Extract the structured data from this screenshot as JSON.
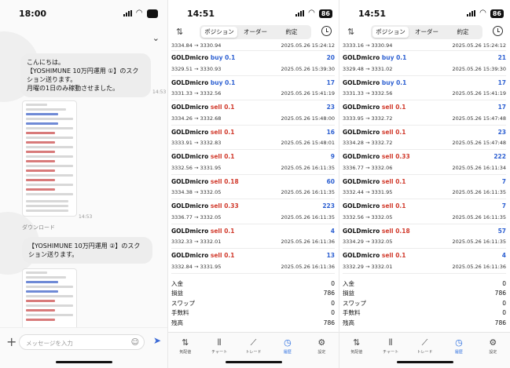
{
  "chat": {
    "status_time": "18:00",
    "messages": [
      {
        "lines": [
          "こんにちは。",
          "【YOSHIMUNE 10万円運用 ①】のスク",
          "ション送ります。",
          "月曜の1日のみ稼動させました。"
        ],
        "time": "14:53"
      },
      {
        "time": "14:53"
      },
      {
        "lines": [
          "【YOSHIMUNE 10万円運用 ②】のスク",
          "ション送ります。"
        ]
      }
    ],
    "download_label": "ダウンロード",
    "input_placeholder": "メッセージを入力"
  },
  "panels": [
    {
      "status_time": "14:51",
      "battery": "86",
      "tabs": [
        "ポジション",
        "オーダー",
        "約定"
      ],
      "active_tab": 0,
      "first_row": {
        "prices": "3334.84 → 3330.94",
        "datetime": "2025.05.26 15:24:12"
      },
      "trades": [
        {
          "symbol": "GOLDmicro",
          "side": "buy",
          "lots": "0.1",
          "pl": "20",
          "prices": "3329.51 → 3330.93",
          "datetime": "2025.05.26 15:39:30"
        },
        {
          "symbol": "GOLDmicro",
          "side": "buy",
          "lots": "0.1",
          "pl": "17",
          "prices": "3331.33 → 3332.56",
          "datetime": "2025.05.26 15:41:19"
        },
        {
          "symbol": "GOLDmicro",
          "side": "sell",
          "lots": "0.1",
          "pl": "23",
          "prices": "3334.26 → 3332.68",
          "datetime": "2025.05.26 15:48:00"
        },
        {
          "symbol": "GOLDmicro",
          "side": "sell",
          "lots": "0.1",
          "pl": "16",
          "prices": "3333.91 → 3332.83",
          "datetime": "2025.05.26 15:48:01"
        },
        {
          "symbol": "GOLDmicro",
          "side": "sell",
          "lots": "0.1",
          "pl": "9",
          "prices": "3332.56 → 3331.95",
          "datetime": "2025.05.26 16:11:35"
        },
        {
          "symbol": "GOLDmicro",
          "side": "sell",
          "lots": "0.18",
          "pl": "60",
          "prices": "3334.38 → 3332.05",
          "datetime": "2025.05.26 16:11:35"
        },
        {
          "symbol": "GOLDmicro",
          "side": "sell",
          "lots": "0.33",
          "pl": "223",
          "prices": "3336.77 → 3332.05",
          "datetime": "2025.05.26 16:11:35"
        },
        {
          "symbol": "GOLDmicro",
          "side": "sell",
          "lots": "0.1",
          "pl": "4",
          "prices": "3332.33 → 3332.01",
          "datetime": "2025.05.26 16:11:36"
        },
        {
          "symbol": "GOLDmicro",
          "side": "sell",
          "lots": "0.1",
          "pl": "13",
          "prices": "3332.84 → 3331.95",
          "datetime": "2025.05.26 16:11:36"
        }
      ],
      "summary": [
        {
          "label": "入金",
          "value": "0"
        },
        {
          "label": "損益",
          "value": "786"
        },
        {
          "label": "スワップ",
          "value": "0"
        },
        {
          "label": "手数料",
          "value": "0"
        },
        {
          "label": "残高",
          "value": "786"
        }
      ],
      "tabbar": [
        "気配値",
        "チャート",
        "トレード",
        "履歴",
        "設定"
      ],
      "active_tabbar": 3
    },
    {
      "status_time": "14:51",
      "battery": "86",
      "tabs": [
        "ポジション",
        "オーダー",
        "約定"
      ],
      "active_tab": 0,
      "first_row": {
        "prices": "3333.16 → 3330.94",
        "datetime": "2025.05.26 15:24:12"
      },
      "trades": [
        {
          "symbol": "GOLDmicro",
          "side": "buy",
          "lots": "0.1",
          "pl": "21",
          "prices": "3329.48 → 3331.02",
          "datetime": "2025.05.26 15:39:30"
        },
        {
          "symbol": "GOLDmicro",
          "side": "buy",
          "lots": "0.1",
          "pl": "17",
          "prices": "3331.33 → 3332.56",
          "datetime": "2025.05.26 15:41:19"
        },
        {
          "symbol": "GOLDmicro",
          "side": "sell",
          "lots": "0.1",
          "pl": "17",
          "prices": "3333.95 → 3332.72",
          "datetime": "2025.05.26 15:47:48"
        },
        {
          "symbol": "GOLDmicro",
          "side": "sell",
          "lots": "0.1",
          "pl": "23",
          "prices": "3334.28 → 3332.72",
          "datetime": "2025.05.26 15:47:48"
        },
        {
          "symbol": "GOLDmicro",
          "side": "sell",
          "lots": "0.33",
          "pl": "222",
          "prices": "3336.77 → 3332.06",
          "datetime": "2025.05.26 16:11:34"
        },
        {
          "symbol": "GOLDmicro",
          "side": "sell",
          "lots": "0.1",
          "pl": "7",
          "prices": "3332.44 → 3331.95",
          "datetime": "2025.05.26 16:11:35"
        },
        {
          "symbol": "GOLDmicro",
          "side": "sell",
          "lots": "0.1",
          "pl": "7",
          "prices": "3332.56 → 3332.05",
          "datetime": "2025.05.26 16:11:35"
        },
        {
          "symbol": "GOLDmicro",
          "side": "sell",
          "lots": "0.18",
          "pl": "57",
          "prices": "3334.29 → 3332.05",
          "datetime": "2025.05.26 16:11:35"
        },
        {
          "symbol": "GOLDmicro",
          "side": "sell",
          "lots": "0.1",
          "pl": "4",
          "prices": "3332.29 → 3332.01",
          "datetime": "2025.05.26 16:11:36"
        }
      ],
      "summary": [
        {
          "label": "入金",
          "value": "0"
        },
        {
          "label": "損益",
          "value": "786"
        },
        {
          "label": "スワップ",
          "value": "0"
        },
        {
          "label": "手数料",
          "value": "0"
        },
        {
          "label": "残高",
          "value": "786"
        }
      ],
      "tabbar": [
        "気配値",
        "チャート",
        "トレード",
        "履歴",
        "設定"
      ],
      "active_tabbar": 3
    }
  ],
  "colors": {
    "buy": "#2c5fd1",
    "sell": "#d13a2c",
    "profit": "#2c5fd1",
    "active_tab": "#2c6fe0"
  },
  "icons": {
    "tabbar": [
      "quotes-icon",
      "chart-icon",
      "trade-icon",
      "history-icon",
      "settings-icon"
    ]
  }
}
